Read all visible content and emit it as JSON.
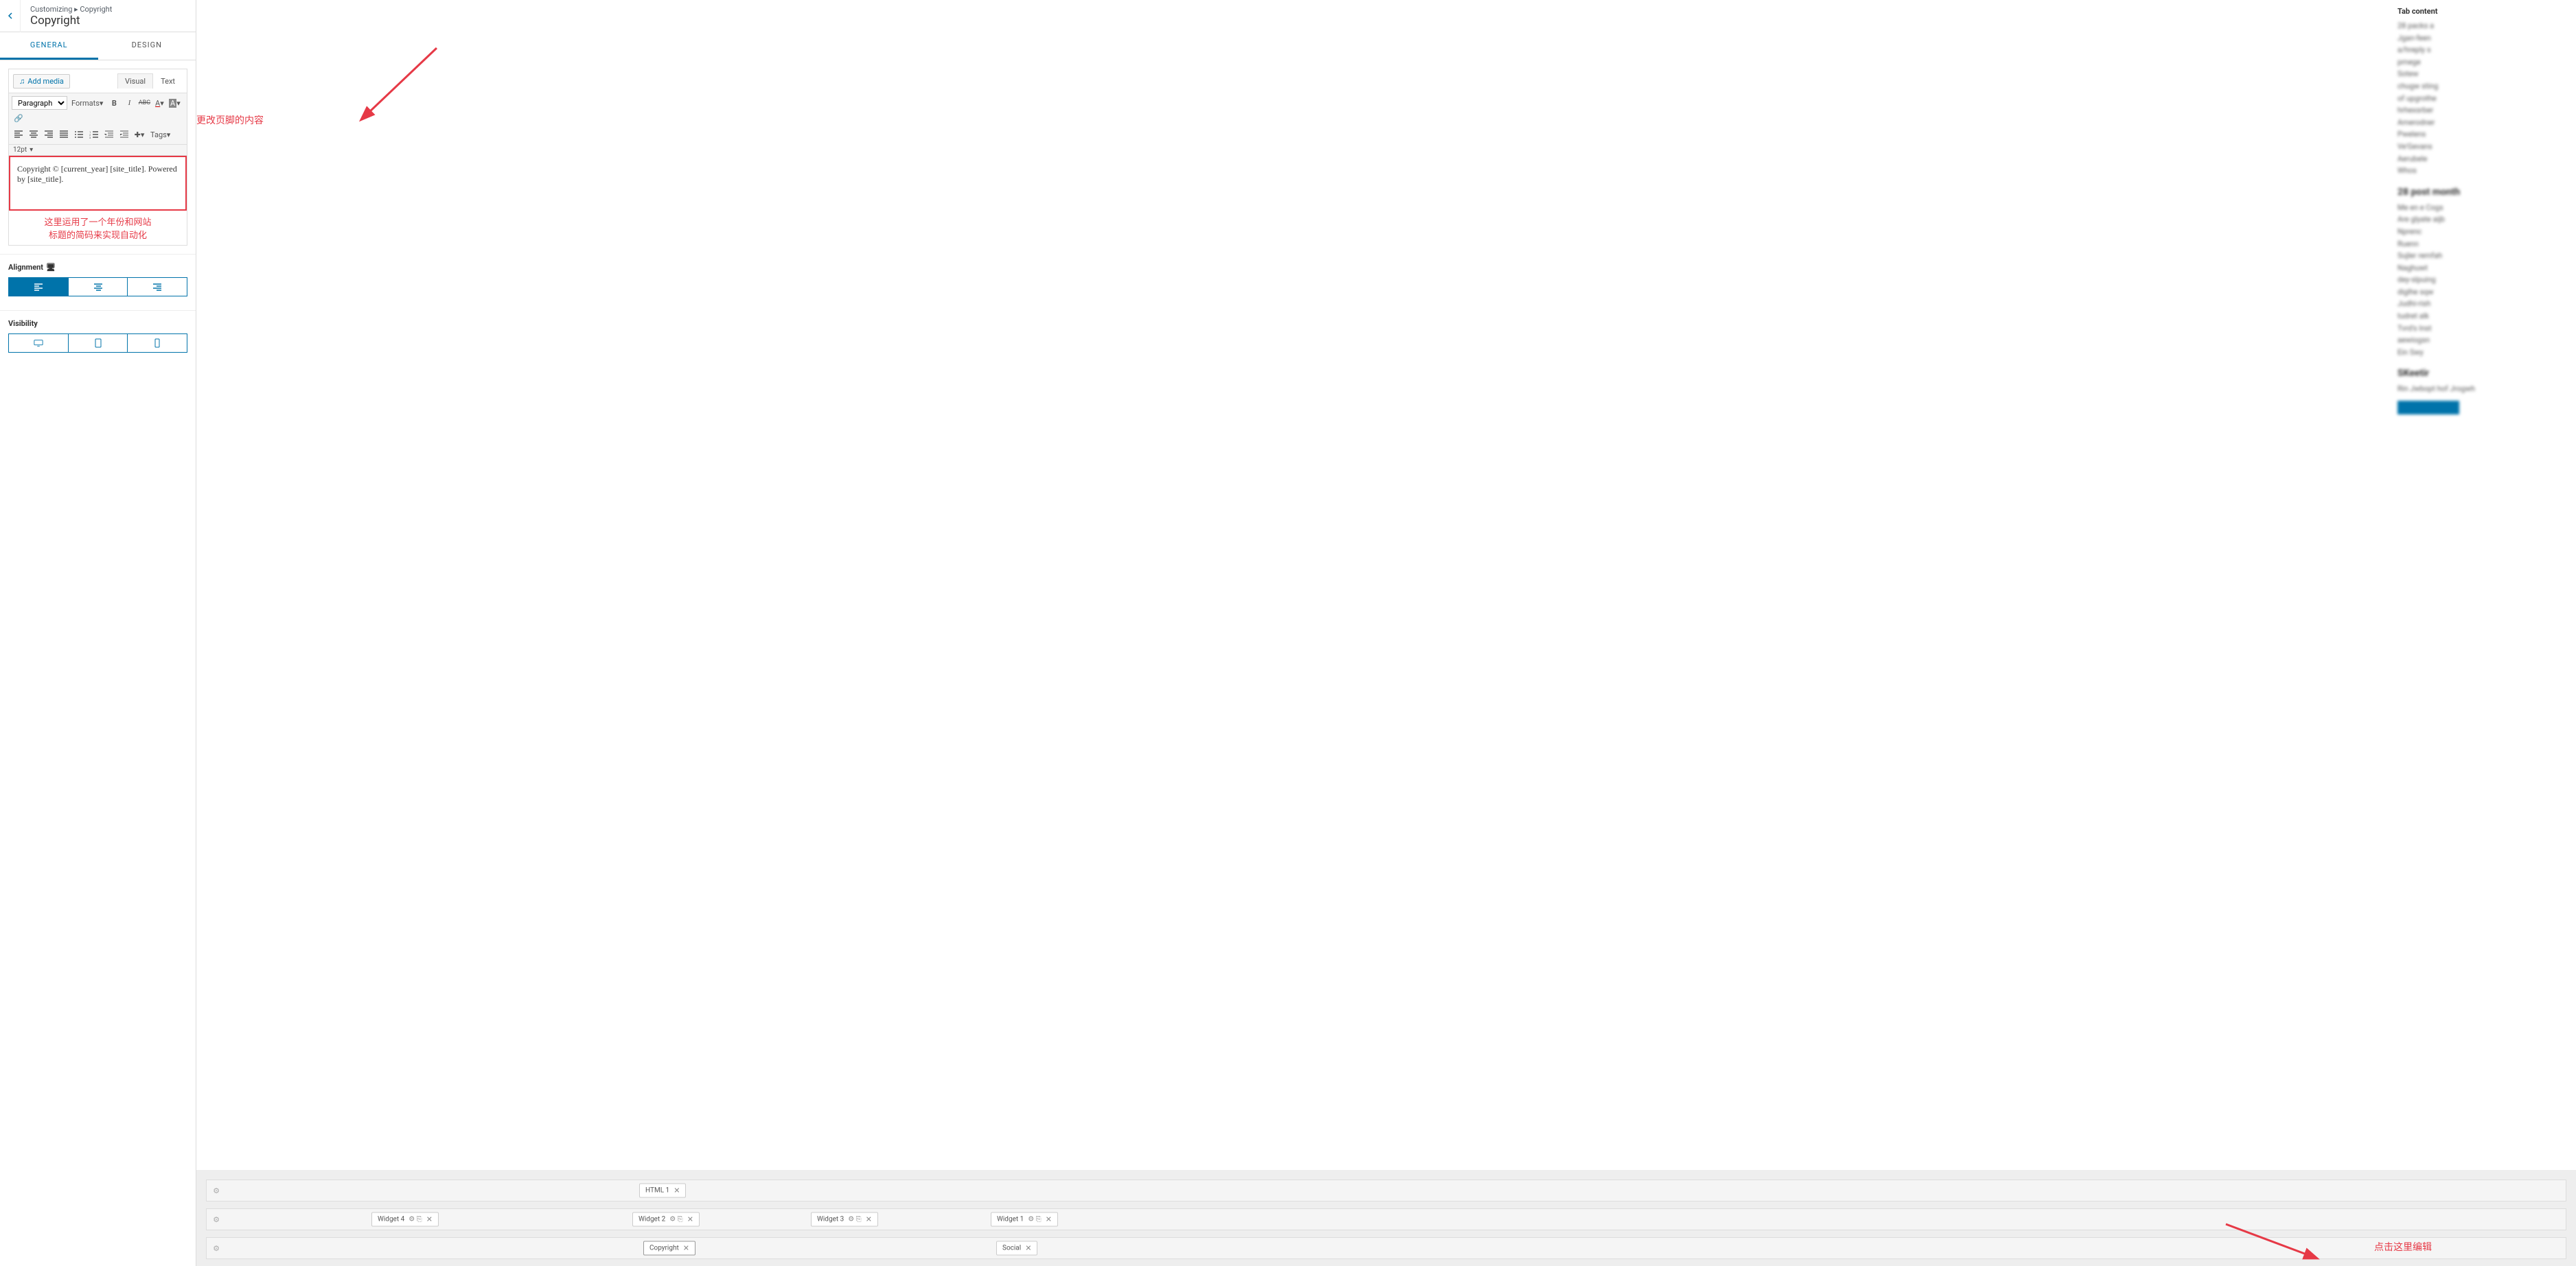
{
  "header": {
    "breadcrumb": "Customizing ▸ Copyright",
    "title": "Copyright"
  },
  "tabs": {
    "general": "GENERAL",
    "design": "DESIGN"
  },
  "editor": {
    "add_media": "Add media",
    "tab_visual": "Visual",
    "tab_text": "Text",
    "paragraph": "Paragraph",
    "formats": "Formats",
    "tags": "Tags",
    "font_size": "12pt",
    "content": "Copyright © [current_year] [site_title]. Powered by [site_title]."
  },
  "annotations": {
    "top_arrow": "更改页脚的内容",
    "shortcode_note_1": "这里运用了一个年份和网站",
    "shortcode_note_2": "标题的简码来实现自动化",
    "bottom_arrow": "点击这里编辑"
  },
  "sections": {
    "alignment": "Alignment",
    "visibility": "Visibility"
  },
  "preview": {
    "tab_content_title": "Tab content",
    "footer_rows": [
      {
        "tags": [
          {
            "label": "HTML 1",
            "pos": 630,
            "close": true
          }
        ]
      },
      {
        "tags": [
          {
            "label": "Widget 4",
            "pos": 240,
            "icons": true,
            "close": true
          },
          {
            "label": "Widget 2",
            "pos": 620,
            "icons": true,
            "close": true
          },
          {
            "label": "Widget 3",
            "pos": 880,
            "icons": true,
            "close": true
          },
          {
            "label": "Widget 1",
            "pos": 1142,
            "icons": true,
            "close": true
          }
        ]
      },
      {
        "tags": [
          {
            "label": "Copyright",
            "pos": 636,
            "close": true,
            "highlight": true
          },
          {
            "label": "Social",
            "pos": 1150,
            "close": true
          }
        ]
      }
    ]
  }
}
